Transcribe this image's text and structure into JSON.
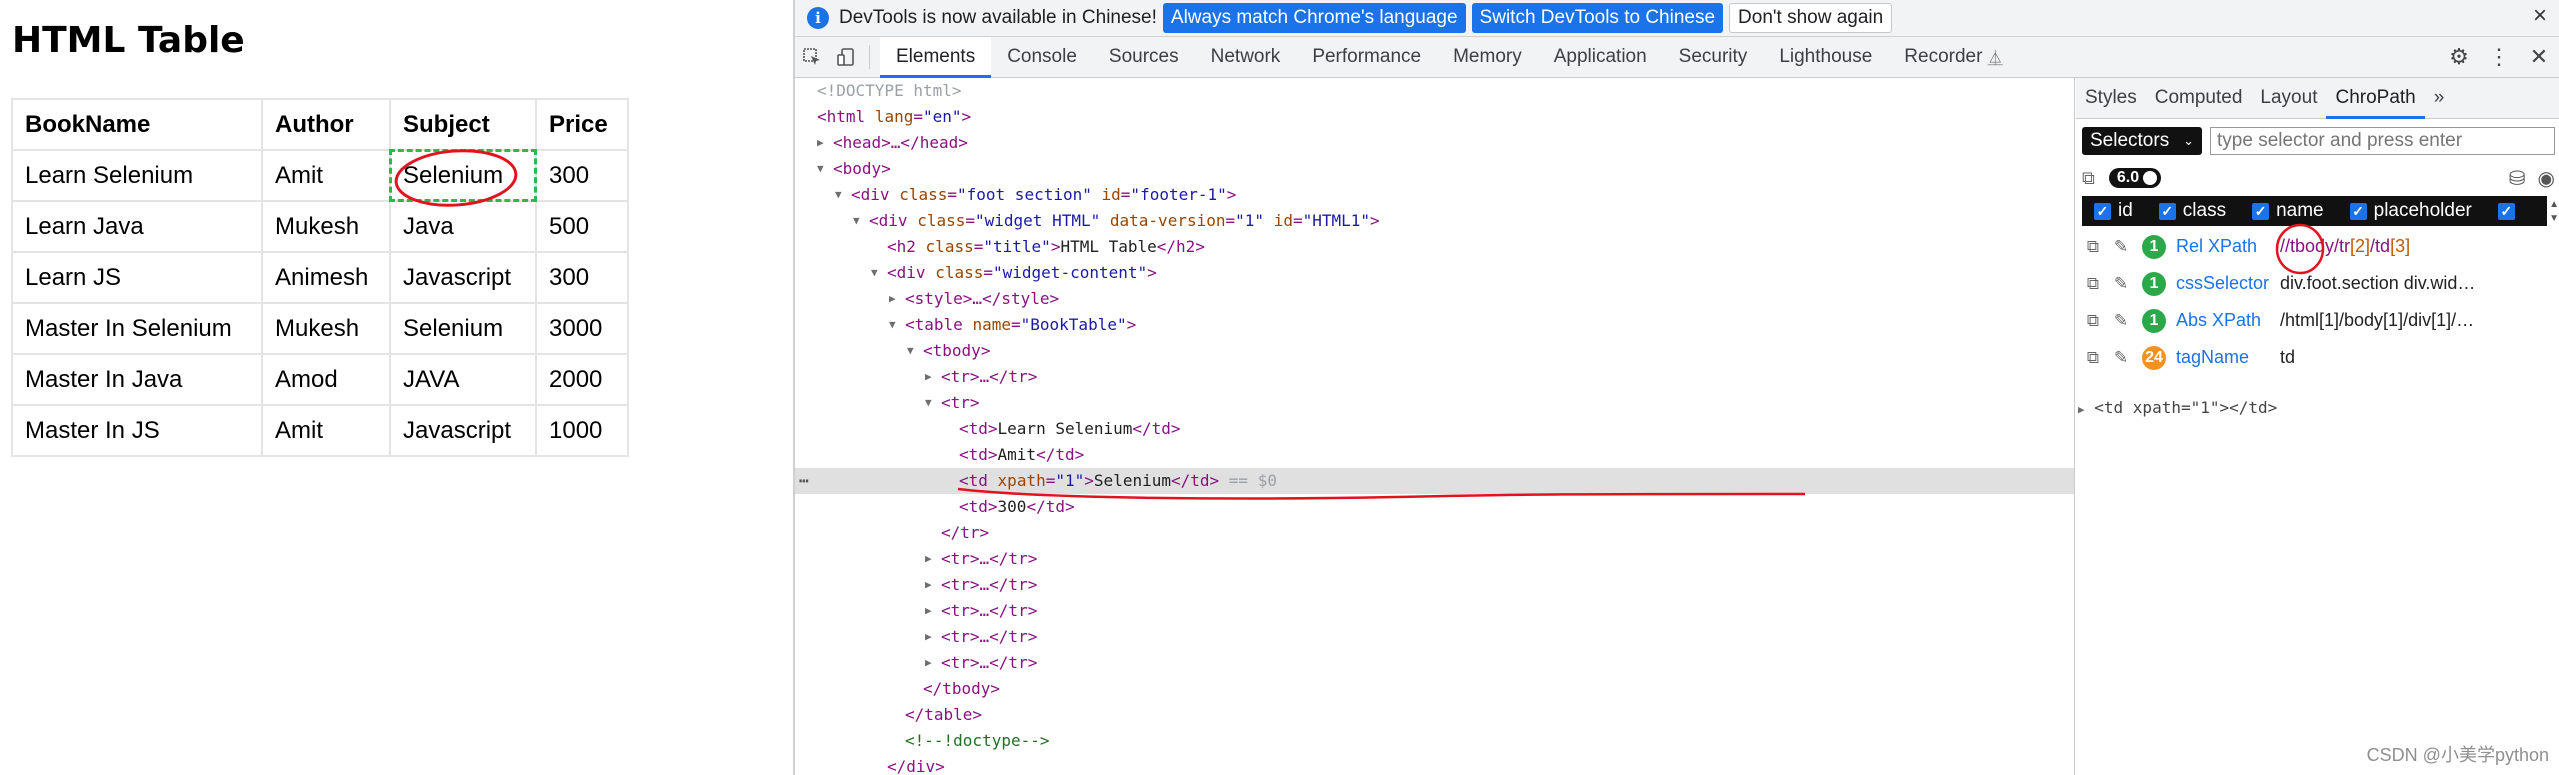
{
  "page": {
    "heading": "HTML Table",
    "table": {
      "headers": [
        "BookName",
        "Author",
        "Subject",
        "Price"
      ],
      "rows": [
        [
          "Learn Selenium",
          "Amit",
          "Selenium",
          "300"
        ],
        [
          "Learn Java",
          "Mukesh",
          "Java",
          "500"
        ],
        [
          "Learn JS",
          "Animesh",
          "Javascript",
          "300"
        ],
        [
          "Master In Selenium",
          "Mukesh",
          "Selenium",
          "3000"
        ],
        [
          "Master In Java",
          "Amod",
          "JAVA",
          "2000"
        ],
        [
          "Master In JS",
          "Amit",
          "Javascript",
          "1000"
        ]
      ]
    }
  },
  "infobar": {
    "message": "DevTools is now available in Chinese!",
    "btn_match": "Always match Chrome's language",
    "btn_switch": "Switch DevTools to Chinese",
    "btn_dismiss": "Don't show again",
    "close": "×"
  },
  "toolbar": {
    "tabs": [
      "Elements",
      "Console",
      "Sources",
      "Network",
      "Performance",
      "Memory",
      "Application",
      "Security",
      "Lighthouse",
      "Recorder"
    ],
    "recorder_icon": "⏅"
  },
  "dom": {
    "doctype": "<!DOCTYPE html>",
    "html_open": [
      "html",
      "lang",
      "en"
    ],
    "head": "<head>…</head>",
    "body": "body",
    "div1": [
      "div",
      "class",
      "foot section",
      "id",
      "footer-1"
    ],
    "div2": [
      "div",
      "class",
      "widget HTML",
      "data-version",
      "1",
      "id",
      "HTML1"
    ],
    "h2": [
      "h2",
      "class",
      "title",
      "HTML Table"
    ],
    "div3": [
      "div",
      "class",
      "widget-content"
    ],
    "style": "<style>…</style>",
    "table": [
      "table",
      "name",
      "BookTable"
    ],
    "tbody": "tbody",
    "tr_collapsed": "<tr>…</tr>",
    "tr": "tr",
    "td1": "Learn Selenium",
    "td2": "Amit",
    "td3_attr": [
      "xpath",
      "1"
    ],
    "td3": "Selenium",
    "selected_suffix": " == $0",
    "td4": "300",
    "tr_close": "</tr>",
    "tbody_close": "</tbody>",
    "table_close": "</table>",
    "comment": "<!--!doctype-->",
    "div_close": "</div>"
  },
  "side": {
    "tabs": [
      "Styles",
      "Computed",
      "Layout",
      "ChroPath"
    ],
    "more": "»",
    "selector_dropdown": "Selectors",
    "selector_placeholder": "type selector and press enter",
    "version": "6.0",
    "attrs": [
      "id",
      "class",
      "name",
      "placeholder"
    ],
    "locators": [
      {
        "count": "1",
        "name": "Rel XPath",
        "value_parts": [
          "//tbody/tr",
          "[2]",
          "/td",
          "[3]"
        ]
      },
      {
        "count": "1",
        "name": "cssSelector",
        "value": "div.foot.section div.wid…"
      },
      {
        "count": "1",
        "name": "Abs XPath",
        "value": "/html[1]/body[1]/div[1]/…"
      },
      {
        "count": "24",
        "name": "tagName",
        "value": "td"
      }
    ],
    "dom_preview": "<td xpath=\"1\"></td>"
  },
  "watermark": "CSDN @小美学python",
  "colors": {
    "accent": "#1a73e8",
    "highlight_dash": "#2db84d",
    "annotation": "#e0141e"
  }
}
